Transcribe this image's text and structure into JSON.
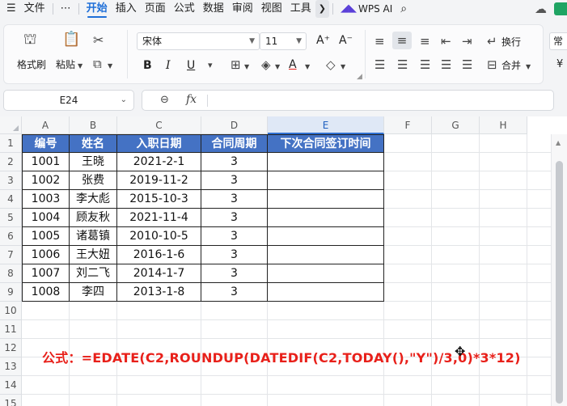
{
  "menubar": {
    "items": [
      "文件",
      "⋯",
      "开始",
      "插入",
      "页面",
      "公式",
      "数据",
      "审阅",
      "视图",
      "工具"
    ],
    "active_index": 2,
    "wps_ai": "WPS AI"
  },
  "ribbon": {
    "format_painter": "格式刷",
    "paste": "粘贴",
    "font_name": "宋体",
    "font_size": "11",
    "wrap_text": "换行",
    "merge": "合并",
    "bold": "B",
    "italic": "I",
    "underline": "U",
    "font_grow": "A⁺",
    "font_shrink": "A⁻",
    "font_color_glyph": "A",
    "overflow_right": "常",
    "overflow_right2": "¥"
  },
  "formula_bar": {
    "cell_ref": "E24",
    "fx": "fx",
    "content": ""
  },
  "sheet": {
    "columns": [
      "A",
      "B",
      "C",
      "D",
      "E",
      "F",
      "G",
      "H"
    ],
    "selected_column": "E",
    "rows": [
      "1",
      "2",
      "3",
      "4",
      "5",
      "6",
      "7",
      "8",
      "9",
      "10",
      "11",
      "12",
      "13",
      "14",
      "15"
    ],
    "header": [
      "编号",
      "姓名",
      "入职日期",
      "合同周期",
      "下次合同签订时间"
    ],
    "data": [
      [
        "1001",
        "王晓",
        "2021-2-1",
        "3",
        ""
      ],
      [
        "1002",
        "张费",
        "2019-11-2",
        "3",
        ""
      ],
      [
        "1003",
        "李大彪",
        "2015-10-3",
        "3",
        ""
      ],
      [
        "1004",
        "顾友秋",
        "2021-11-4",
        "3",
        ""
      ],
      [
        "1005",
        "诸葛镇",
        "2010-10-5",
        "3",
        ""
      ],
      [
        "1006",
        "王大妞",
        "2016-1-6",
        "3",
        ""
      ],
      [
        "1007",
        "刘二飞",
        "2014-1-7",
        "3",
        ""
      ],
      [
        "1008",
        "李四",
        "2013-1-8",
        "3",
        ""
      ]
    ],
    "formula_note": "公式：=EDATE(C2,ROUNDUP(DATEDIF(C2,TODAY(),\"Y\")/3,0)*3*12)"
  },
  "colors": {
    "header_fill": "#4472c4",
    "accent": "#1f6fd8",
    "note_red": "#e8201a"
  }
}
